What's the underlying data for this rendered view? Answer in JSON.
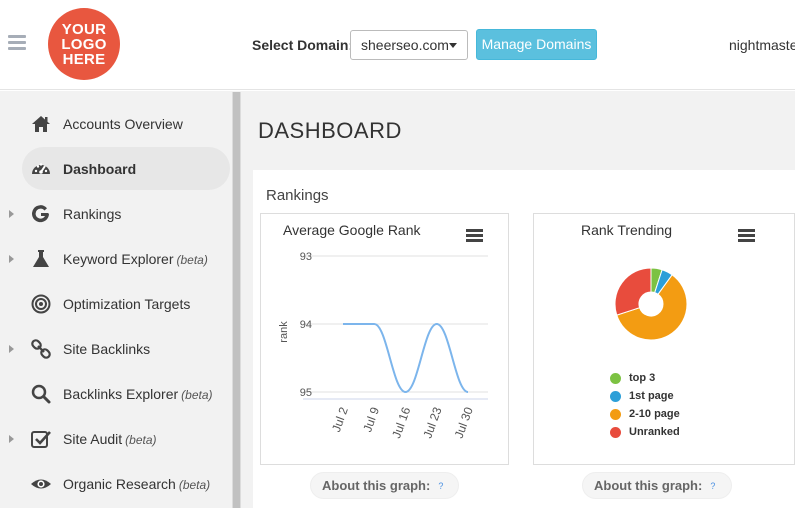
{
  "header": {
    "logo_line1": "YOUR",
    "logo_line2": "LOGO",
    "logo_line3": "HERE",
    "select_domain_label": "Select Domain:",
    "selected_domain": "sheerseo.com",
    "manage_domains_label": "Manage Domains",
    "username": "nightmaste"
  },
  "sidebar": {
    "items": [
      {
        "label": "Accounts Overview",
        "beta": "",
        "icon": "home-icon"
      },
      {
        "label": "Dashboard",
        "beta": "",
        "icon": "gauge-icon"
      },
      {
        "label": "Rankings",
        "beta": "",
        "icon": "google-icon"
      },
      {
        "label": "Keyword Explorer",
        "beta": "(beta)",
        "icon": "flask-icon"
      },
      {
        "label": "Optimization Targets",
        "beta": "",
        "icon": "target-icon"
      },
      {
        "label": "Site Backlinks",
        "beta": "",
        "icon": "link-icon"
      },
      {
        "label": "Backlinks Explorer",
        "beta": "(beta)",
        "icon": "search-icon"
      },
      {
        "label": "Site Audit",
        "beta": "(beta)",
        "icon": "checkbox-icon"
      },
      {
        "label": "Organic Research",
        "beta": "(beta)",
        "icon": "eye-icon"
      }
    ]
  },
  "main": {
    "page_title": "DASHBOARD",
    "section_title": "Rankings",
    "about_label": "About this graph:",
    "about_icon": "?"
  },
  "colors": {
    "accent": "#5bc0de",
    "logo": "#e8573f",
    "line": "#7cb5ec",
    "top3": "#7cc242",
    "first_page": "#2c9fd8",
    "page_2_10": "#f39c12",
    "unranked": "#e84c3d"
  },
  "chart_data": [
    {
      "type": "line",
      "title": "Average Google Rank",
      "xlabel": "",
      "ylabel": "rank",
      "x": [
        "Jul 2",
        "Jul 9",
        "Jul 16",
        "Jul 23",
        "Jul 30"
      ],
      "y_tick_labels": [
        "93",
        "94",
        "95"
      ],
      "ylim": [
        93,
        95
      ],
      "y_reversed": true,
      "series": [
        {
          "values": [
            94,
            94,
            95,
            94,
            95
          ]
        }
      ],
      "grid": true
    },
    {
      "type": "pie",
      "title": "Rank Trending",
      "donut": true,
      "legend_position": "bottom",
      "slices": [
        {
          "label": "top 3",
          "value": 5
        },
        {
          "label": "1st page",
          "value": 5
        },
        {
          "label": "2-10 page",
          "value": 60
        },
        {
          "label": "Unranked",
          "value": 30
        }
      ]
    }
  ]
}
